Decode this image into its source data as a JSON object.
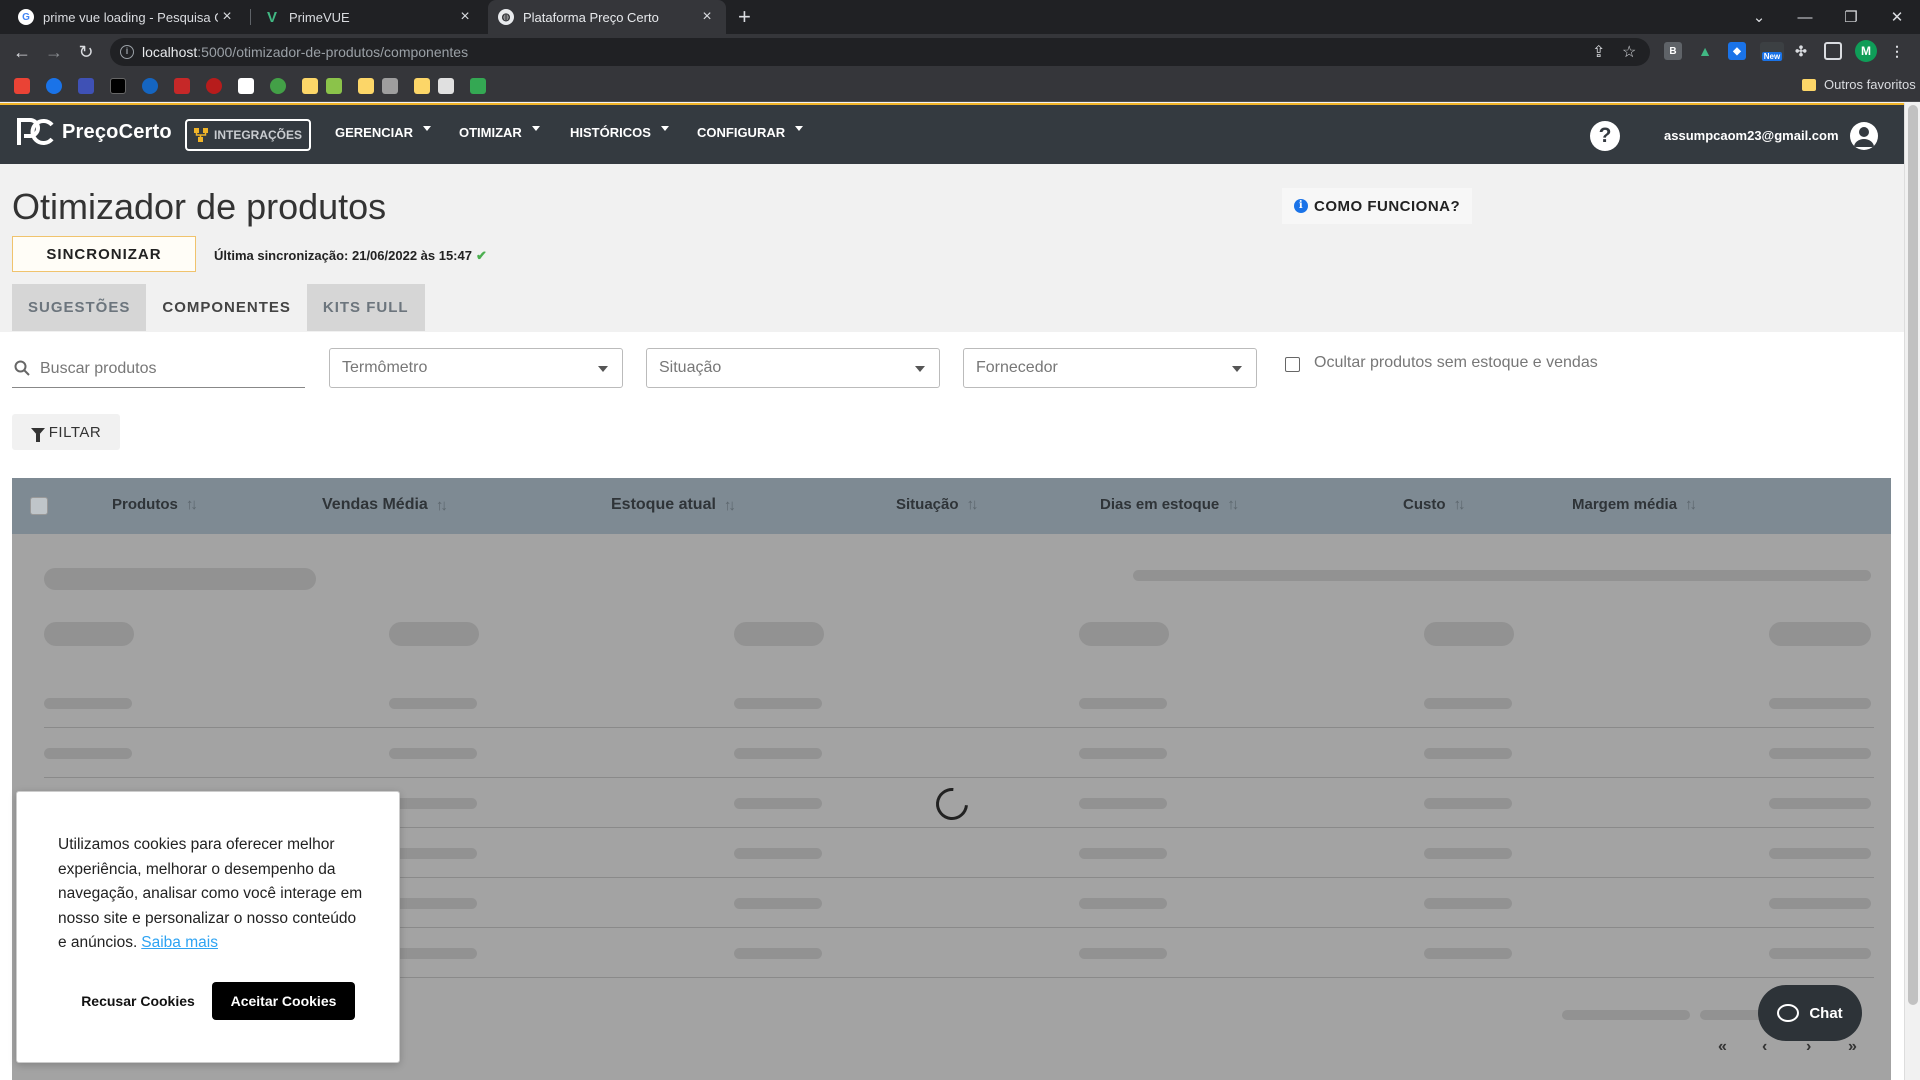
{
  "browser": {
    "tabs": [
      {
        "title": "prime vue loading - Pesquisa Go",
        "favicon": "google-icon"
      },
      {
        "title": "PrimeVUE",
        "favicon": "primevue-icon"
      },
      {
        "title": "Plataforma Preço Certo",
        "favicon": "globe-icon"
      }
    ],
    "url_host": "localhost",
    "url_path": ":5000/otimizador-de-produtos/componentes",
    "bookmarks_folder": "Outros favoritos",
    "profile_initial": "M",
    "ext_badge": "New"
  },
  "header": {
    "logo_text": "PreçoCerto",
    "integrations_label": "INTEGRAÇÕES",
    "menus": [
      "GERENCIAR",
      "OTIMIZAR",
      "HISTÓRICOS",
      "CONFIGURAR"
    ],
    "help_symbol": "?",
    "user_email": "assumpcaom23@gmail.com"
  },
  "page": {
    "title": "Otimizador de produtos",
    "how_it_works": "COMO FUNCIONA?",
    "sync_button": "SINCRONIZAR",
    "last_sync": "Última sincronização: 21/06/2022 às 15:47",
    "tabs": [
      "SUGESTÕES",
      "COMPONENTES",
      "KITS FULL"
    ],
    "active_tab": "COMPONENTES"
  },
  "filters": {
    "search_placeholder": "Buscar produtos",
    "thermometer": "Termômetro",
    "situation": "Situação",
    "supplier": "Fornecedor",
    "hide_checkbox": "Ocultar produtos sem estoque e vendas",
    "filter_button": "FILTAR"
  },
  "table": {
    "columns": [
      "Produtos",
      "Vendas Média",
      "Estoque atual",
      "Situação",
      "Dias em estoque",
      "Custo",
      "Margem média"
    ],
    "loading": true
  },
  "pagination": {
    "first": "«",
    "prev": "‹",
    "next": "›",
    "last": "»"
  },
  "cookie": {
    "message": "Utilizamos cookies para oferecer melhor experiência, melhorar o desempenho da navegação, analisar como você interage em nosso site e personalizar o nosso conteúdo e anúncios.",
    "link": "Saiba mais",
    "refuse": "Recusar Cookies",
    "accept": "Aceitar Cookies"
  },
  "chat": {
    "label": "Chat"
  },
  "colors": {
    "header_bg": "#343a40",
    "accent": "#f0b429",
    "table_header_bg": "#7e8a93",
    "link": "#2ea3f2"
  }
}
